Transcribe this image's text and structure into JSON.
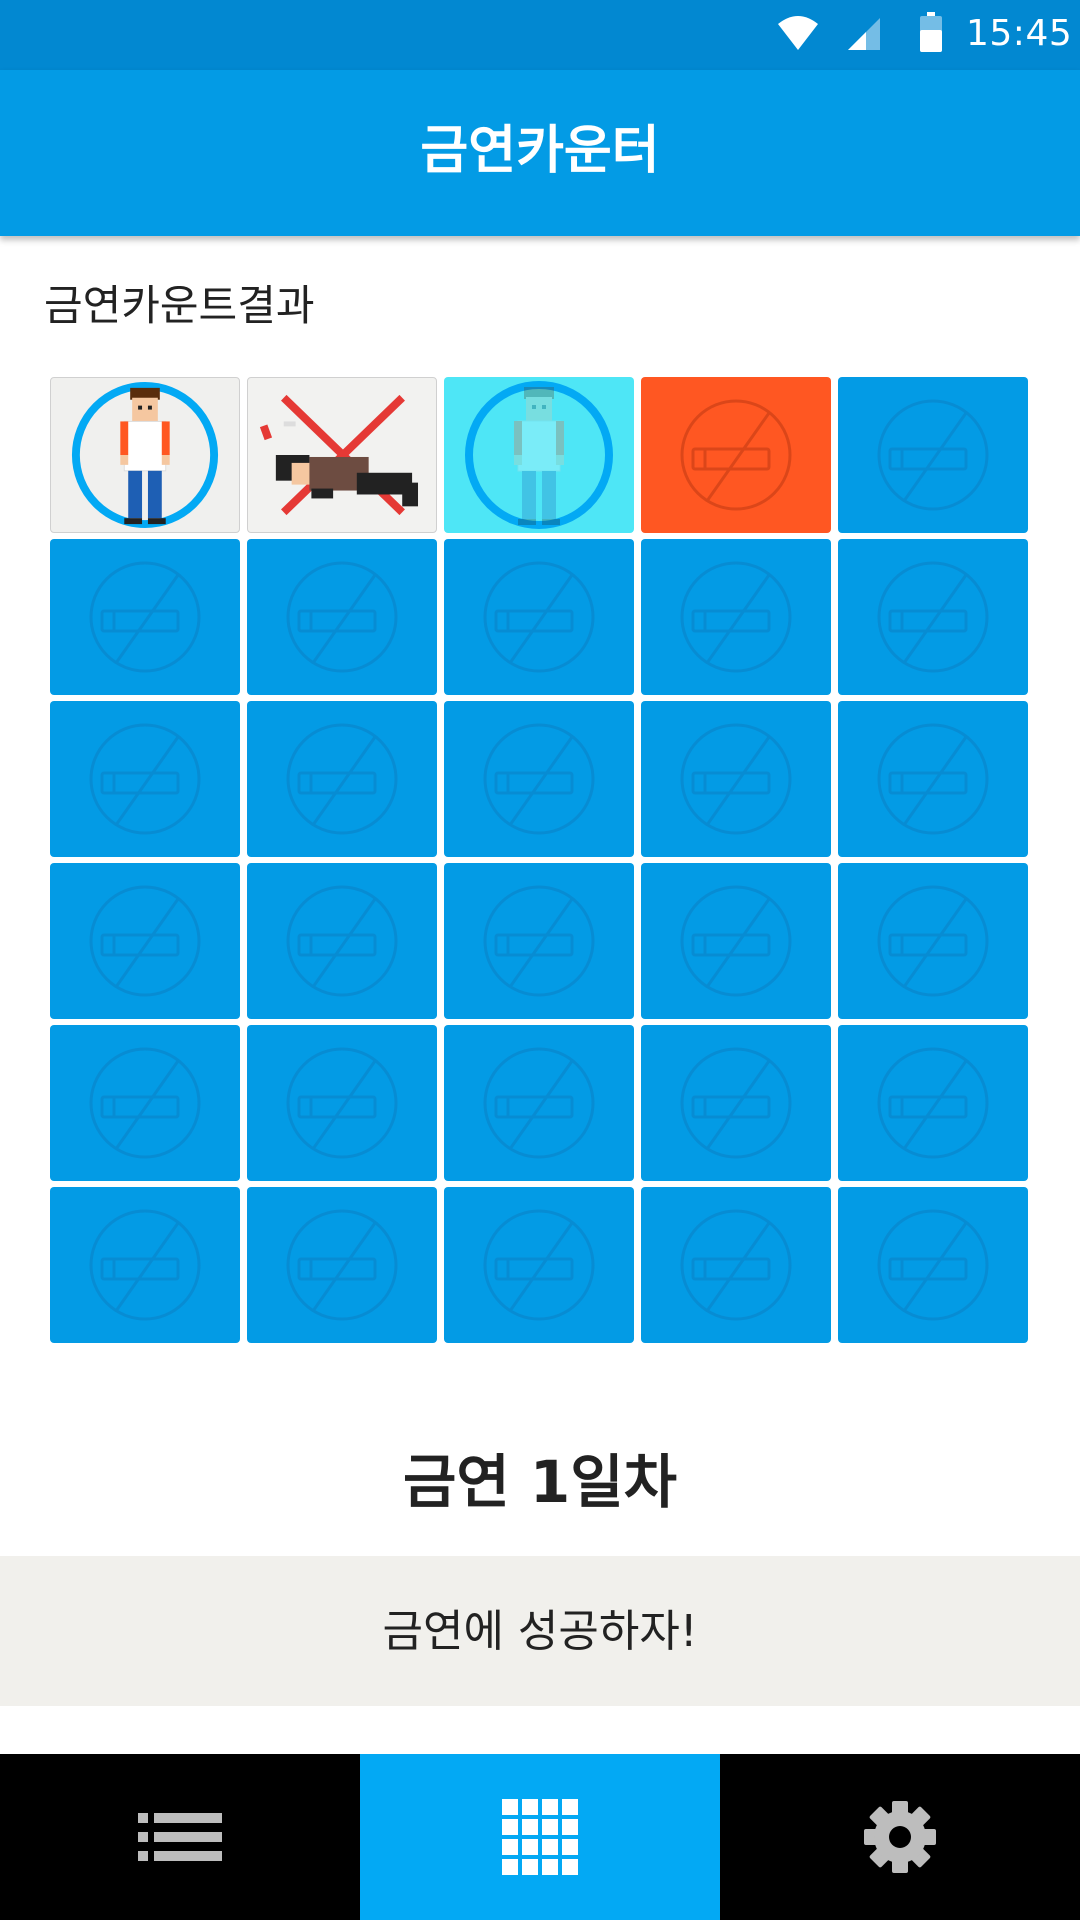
{
  "status_bar": {
    "time": "15:45"
  },
  "app_bar": {
    "title": "금연카운터"
  },
  "section": {
    "label": "금연카운트결과"
  },
  "grid": {
    "columns": 5,
    "rows": 6,
    "special_cells": [
      "success",
      "fail",
      "today",
      "next"
    ],
    "colors": {
      "default": "#039be5",
      "today": "#4ee6f6",
      "next": "#ff5722",
      "icon": "#0a86cc"
    }
  },
  "counter": {
    "text": "금연 1일차"
  },
  "motto": {
    "text": "금연에 성공하자!"
  },
  "nav": {
    "items": [
      {
        "icon": "list-icon",
        "active": false
      },
      {
        "icon": "grid-icon",
        "active": true
      },
      {
        "icon": "gear-icon",
        "active": false
      }
    ]
  }
}
